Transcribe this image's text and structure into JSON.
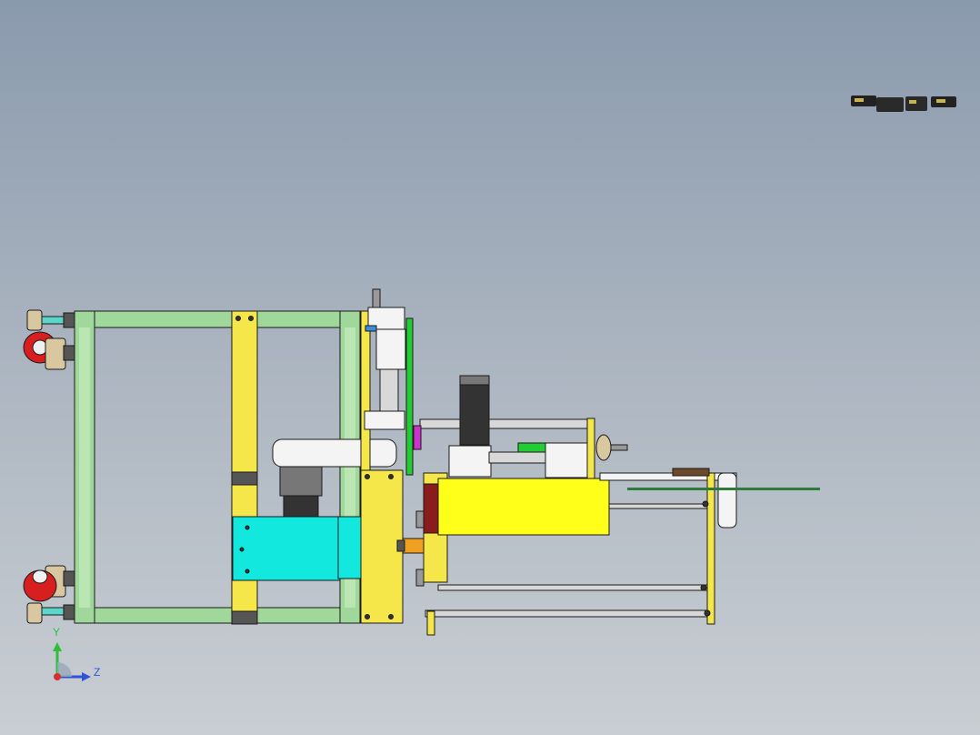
{
  "viewport": {
    "background_top": "#8a9aad",
    "background_bottom": "#c9ced3"
  },
  "triad": {
    "y_label": "Y",
    "z_label": "Z",
    "y_color": "#2fbf3a",
    "z_color": "#2f55d6",
    "x_color": "#d62f2f"
  },
  "colors": {
    "frame_green": "#9fd89a",
    "plate_yellow": "#f5e64a",
    "box_yellow": "#ffff1a",
    "motor_cyan": "#13e8de",
    "wheel_red": "#d81f1f",
    "rod_grey": "#d8d8d8",
    "outline": "#1a1a1a",
    "accent_green": "#22cc33",
    "accent_magenta": "#cc33cc",
    "accent_orange": "#f0a020",
    "accent_darkred": "#8a1c1c",
    "motor_dark": "#333333"
  }
}
